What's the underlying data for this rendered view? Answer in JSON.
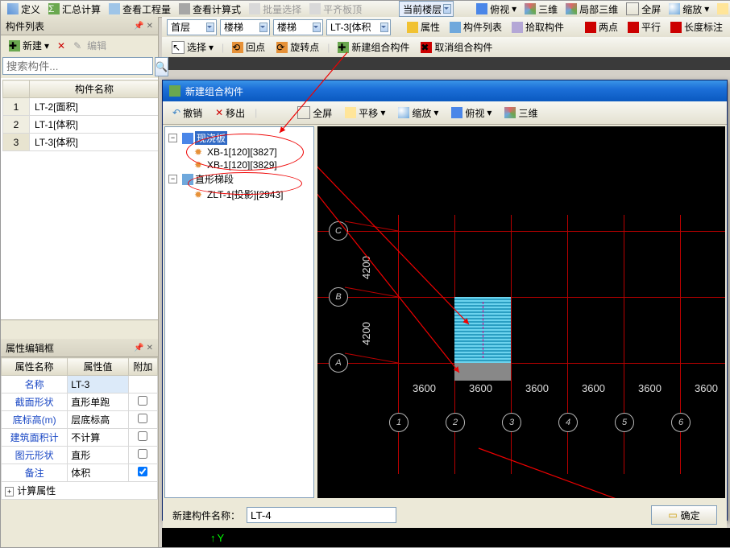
{
  "top_toolbar": {
    "items": [
      "定义",
      "汇总计算",
      "查看工程量",
      "查看计算式",
      "批量选择",
      "平齐板顶"
    ],
    "floor_combo": "当前楼层",
    "right_items": [
      "俯视",
      "三维",
      "局部三维",
      "全屏",
      "缩放",
      "平移"
    ]
  },
  "sec_toolbar": {
    "combo1": "首层",
    "combo2": "楼梯",
    "combo3": "楼梯",
    "combo4": "LT-3[体积",
    "btns": [
      "属性",
      "构件列表",
      "拾取构件"
    ],
    "right": [
      "两点",
      "平行",
      "长度标注"
    ]
  },
  "third_toolbar": {
    "btns": [
      "选择",
      "回点",
      "旋转点",
      "新建组合构件",
      "取消组合构件"
    ]
  },
  "left": {
    "panel_title": "构件列表",
    "new_btn": "新建",
    "edit_btn": "编辑",
    "search_placeholder": "搜索构件...",
    "col_header": "构件名称",
    "rows": [
      {
        "idx": "1",
        "name": "LT-2[面积]"
      },
      {
        "idx": "2",
        "name": "LT-1[体积]"
      },
      {
        "idx": "3",
        "name": "LT-3[体积]"
      }
    ]
  },
  "props": {
    "panel_title": "属性编辑框",
    "cols": [
      "属性名称",
      "属性值",
      "附加"
    ],
    "rows": [
      {
        "name": "名称",
        "val": "LT-3",
        "chk": false,
        "hl": true
      },
      {
        "name": "截面形状",
        "val": "直形单跑",
        "chk": false
      },
      {
        "name": "底标高(m)",
        "val": "层底标高",
        "chk": false
      },
      {
        "name": "建筑面积计",
        "val": "不计算",
        "chk": false
      },
      {
        "name": "图元形状",
        "val": "直形",
        "chk": false
      },
      {
        "name": "备注",
        "val": "体积",
        "chk": true
      }
    ],
    "expand_row": "计算属性"
  },
  "dialog": {
    "title": "新建组合构件",
    "tb": {
      "undo": "撤销",
      "out": "移出",
      "full": "全屏",
      "pan": "平移",
      "zoom": "缩放",
      "top": "俯视",
      "d3": "三维"
    },
    "tree": {
      "n1": "现浇板",
      "n1c": [
        "XB-1[120][3827]",
        "XB-1[120][3829]"
      ],
      "n2": "直形梯段",
      "n2c": [
        "ZLT-1[投影][2943]"
      ]
    },
    "bottom_label": "新建构件名称：",
    "bottom_value": "LT-4",
    "ok": "确定"
  },
  "grid": {
    "rows": [
      "C",
      "B",
      "A"
    ],
    "cols": [
      "1",
      "2",
      "3",
      "4",
      "5",
      "6"
    ],
    "xdims": [
      "3600",
      "3600",
      "3600",
      "3600",
      "3600",
      "3600"
    ],
    "ydims": [
      "4200",
      "4200"
    ]
  },
  "axis_y": "Y"
}
